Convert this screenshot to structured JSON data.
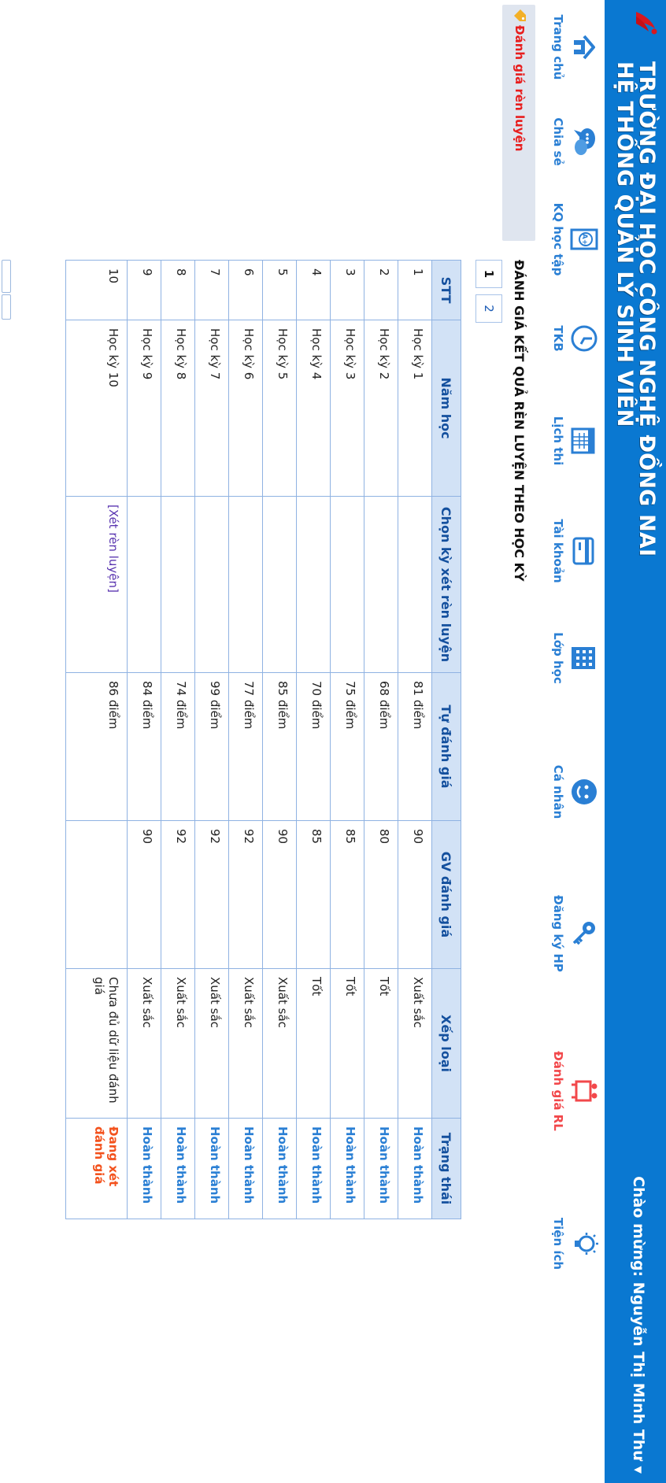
{
  "header": {
    "school_name": "TRƯỜNG ĐẠI HỌC CÔNG NGHỆ ĐỒNG NAI",
    "system_name": "HỆ THỐNG QUẢN LÝ SINH VIÊN",
    "welcome": "Chào mừng: Nguyễn Thị Minh Thư ▾"
  },
  "nav": {
    "items": [
      {
        "label": "Trang chủ",
        "icon": "home-icon"
      },
      {
        "label": "Chia sẻ",
        "icon": "chat-icon"
      },
      {
        "label": "KQ học tập",
        "icon": "grade-report-icon"
      },
      {
        "label": "TKB",
        "icon": "clock-icon"
      },
      {
        "label": "Lịch thi",
        "icon": "calendar-icon"
      },
      {
        "label": "Tài khoản",
        "icon": "card-icon"
      },
      {
        "label": "Lớp học",
        "icon": "building-icon"
      },
      {
        "label": "Cá nhân",
        "icon": "user-face-icon"
      },
      {
        "label": "Đăng ký HP",
        "icon": "key-icon"
      },
      {
        "label": "Đánh giá RL",
        "icon": "people-board-icon"
      },
      {
        "label": "Tiện ích",
        "icon": "lightbulb-icon"
      }
    ],
    "active_color": "#f2484b",
    "color": "#2a7fd4"
  },
  "sidebar": {
    "link": "Đánh giá rèn luyện"
  },
  "main": {
    "heading": "ĐÁNH GIÁ KẾT QUẢ RÈN LUYỆN THEO HỌC KỲ",
    "pager": [
      "1",
      "2"
    ],
    "columns": [
      "STT",
      "Năm học",
      "Chọn kỳ xét rèn luyện",
      "Tự đánh giá",
      "GV đánh giá",
      "Xếp loại",
      "Trạng thái"
    ],
    "rows": [
      {
        "stt": "1",
        "term": "Học kỳ 1",
        "choose": "",
        "self": "81 điểm",
        "gv": "90",
        "rank": "Xuất sắc",
        "status": "Hoàn thành"
      },
      {
        "stt": "2",
        "term": "Học kỳ 2",
        "choose": "",
        "self": "68 điểm",
        "gv": "80",
        "rank": "Tốt",
        "status": "Hoàn thành"
      },
      {
        "stt": "3",
        "term": "Học kỳ 3",
        "choose": "",
        "self": "75 điểm",
        "gv": "85",
        "rank": "Tốt",
        "status": "Hoàn thành"
      },
      {
        "stt": "4",
        "term": "Học kỳ 4",
        "choose": "",
        "self": "70 điểm",
        "gv": "85",
        "rank": "Tốt",
        "status": "Hoàn thành"
      },
      {
        "stt": "5",
        "term": "Học kỳ 5",
        "choose": "",
        "self": "85 điểm",
        "gv": "90",
        "rank": "Xuất sắc",
        "status": "Hoàn thành"
      },
      {
        "stt": "6",
        "term": "Học kỳ 6",
        "choose": "",
        "self": "77 điểm",
        "gv": "92",
        "rank": "Xuất sắc",
        "status": "Hoàn thành"
      },
      {
        "stt": "7",
        "term": "Học kỳ 7",
        "choose": "",
        "self": "99 điểm",
        "gv": "92",
        "rank": "Xuất sắc",
        "status": "Hoàn thành"
      },
      {
        "stt": "8",
        "term": "Học kỳ 8",
        "choose": "",
        "self": "74 điểm",
        "gv": "92",
        "rank": "Xuất sắc",
        "status": "Hoàn thành"
      },
      {
        "stt": "9",
        "term": "Học kỳ 9",
        "choose": "",
        "self": "84 điểm",
        "gv": "90",
        "rank": "Xuất sắc",
        "status": "Hoàn thành"
      },
      {
        "stt": "10",
        "term": "Học kỳ 10",
        "choose": "[Xét rèn luyện]",
        "self": "86 điểm",
        "gv": "",
        "rank": "Chưa đủ dữ liệu đánh giá",
        "status": "Đang xét đánh giá"
      }
    ]
  }
}
